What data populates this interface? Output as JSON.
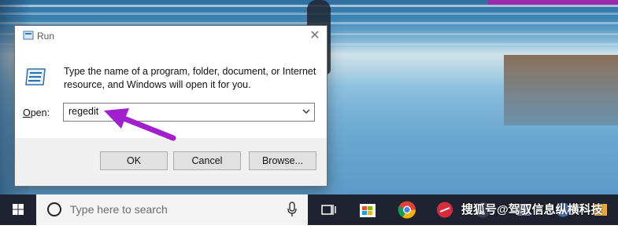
{
  "dialog": {
    "title": "Run",
    "description": "Type the name of a program, folder, document, or Internet resource, and Windows will open it for you.",
    "open_label_prefix": "",
    "open_label_access": "O",
    "open_label_rest": "pen:",
    "open_value": "regedit",
    "buttons": {
      "ok": "OK",
      "cancel": "Cancel",
      "browse": "Browse..."
    },
    "close_glyph": "✕"
  },
  "taskbar": {
    "search_placeholder": "Type here to search",
    "watermark": "搜狐号@驾驭信息纵横科技"
  },
  "colors": {
    "annotation_arrow": "#a020d0",
    "taskbar": "#1f2230"
  },
  "icons": [
    "run-icon",
    "close-icon",
    "chevron-down-icon",
    "windows-start-icon",
    "search-icon",
    "microphone-icon",
    "task-view-icon",
    "store-icon",
    "chrome-icon",
    "app-icon"
  ]
}
